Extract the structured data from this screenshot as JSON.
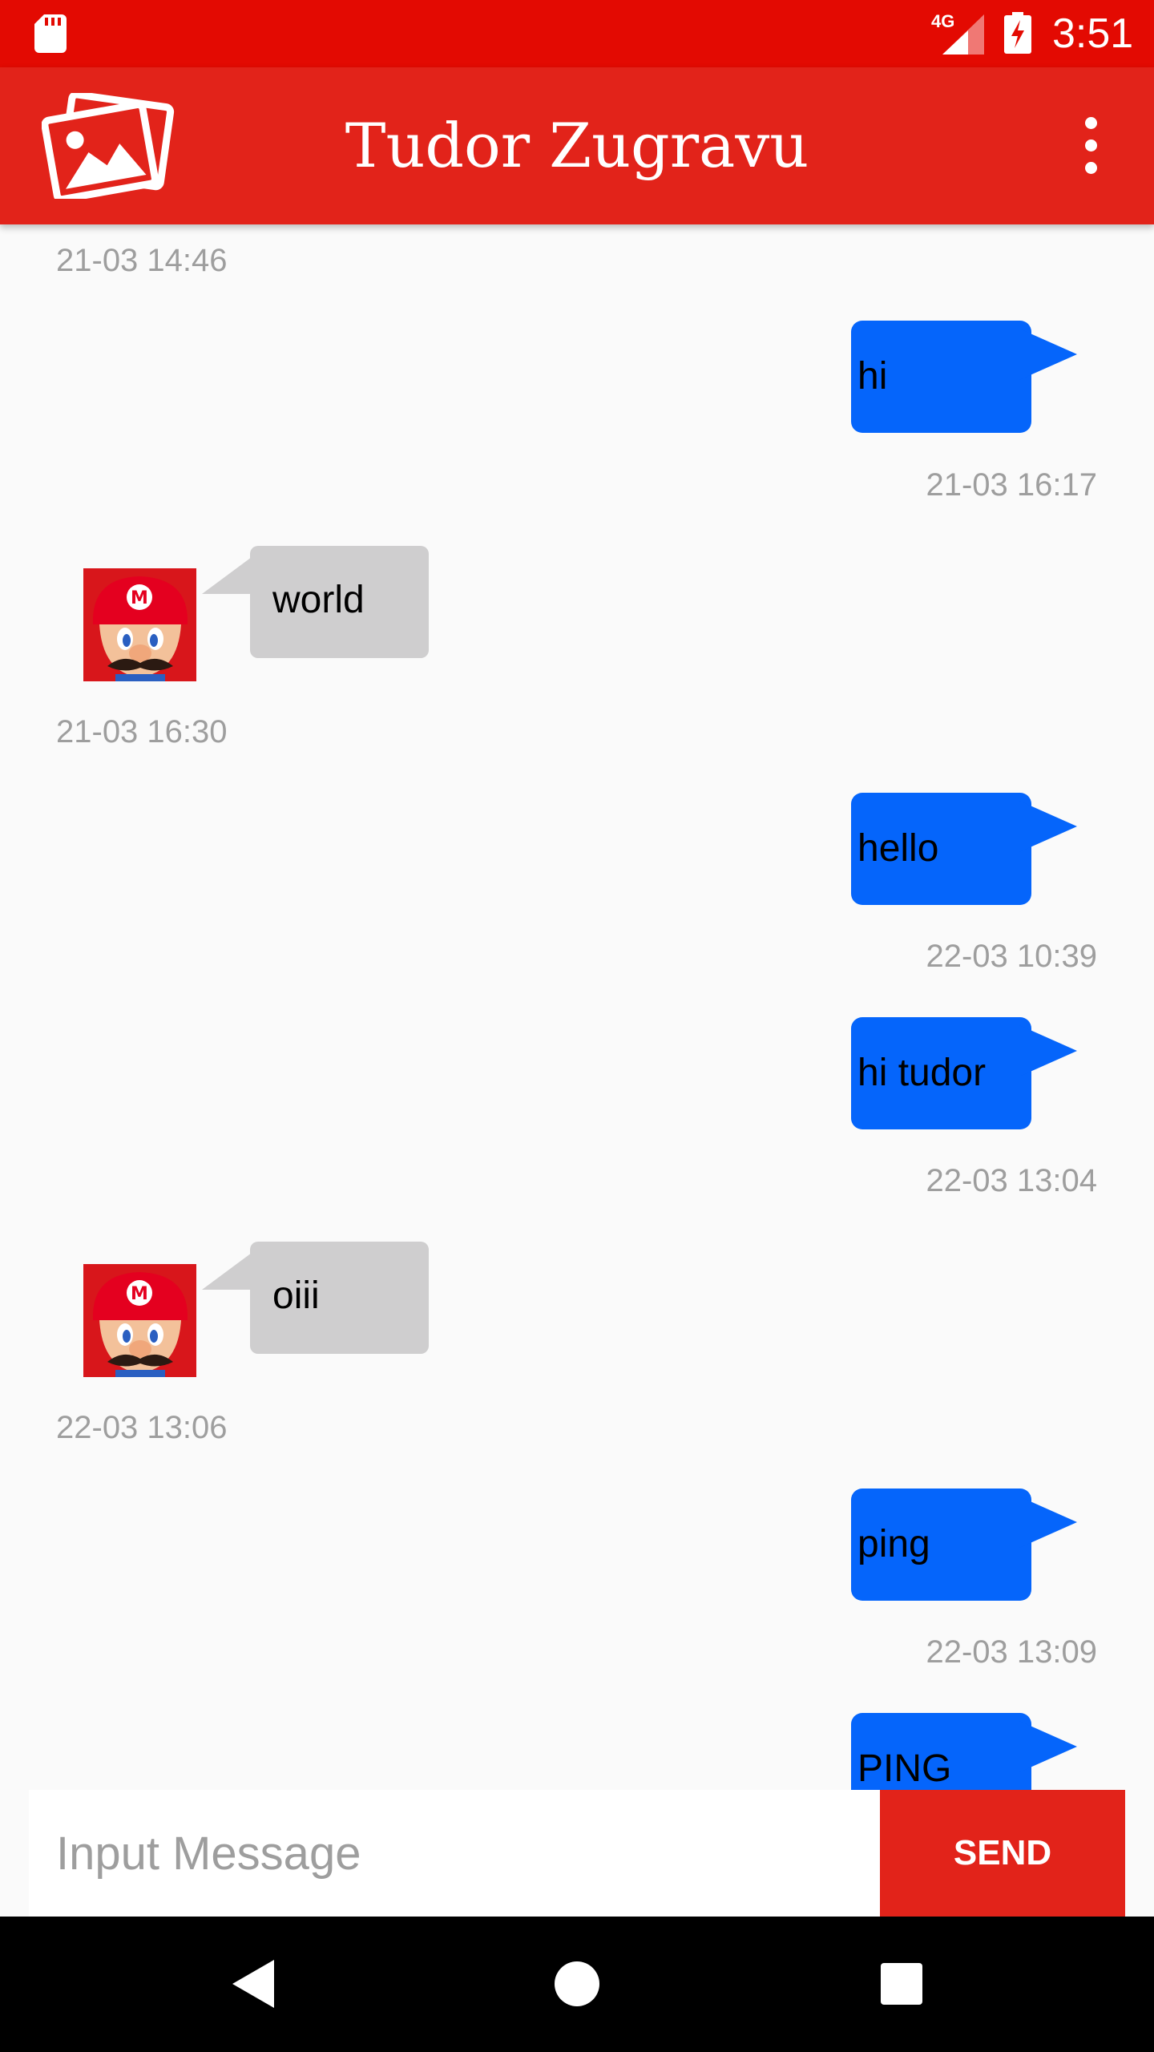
{
  "status_bar": {
    "network_type": "4G",
    "time": "3:51",
    "icons": [
      "sd-card-icon",
      "signal-icon",
      "battery-charging-icon"
    ]
  },
  "app_bar": {
    "title": "Tudor Zugravu",
    "icons": [
      "gallery-icon",
      "overflow-menu-icon"
    ]
  },
  "messages": [
    {
      "direction": "in",
      "text": "",
      "timestamp": "21-03 14:46"
    },
    {
      "direction": "out",
      "text": "hi",
      "timestamp": "21-03 16:17"
    },
    {
      "direction": "in",
      "text": "world",
      "timestamp": "21-03 16:30",
      "avatar": "mario-avatar"
    },
    {
      "direction": "out",
      "text": "hello",
      "timestamp": "22-03 10:39"
    },
    {
      "direction": "out",
      "text": "hi tudor",
      "timestamp": "22-03 13:04"
    },
    {
      "direction": "in",
      "text": "oiii",
      "timestamp": "22-03 13:06",
      "avatar": "mario-avatar"
    },
    {
      "direction": "out",
      "text": "ping",
      "timestamp": "22-03 13:09"
    },
    {
      "direction": "out",
      "text": "PING",
      "timestamp": ""
    }
  ],
  "composer": {
    "placeholder": "Input Message",
    "value": "",
    "send_label": "SEND"
  },
  "nav_bar": {
    "icons": [
      "back-icon",
      "home-icon",
      "recents-icon"
    ]
  },
  "colors": {
    "status_bar": "#e30a02",
    "app_bar": "#e2231a",
    "outgoing_bubble": "#0565fb",
    "incoming_bubble": "#cfcecf",
    "timestamp": "#9e9e9e",
    "background": "#fafafa"
  }
}
